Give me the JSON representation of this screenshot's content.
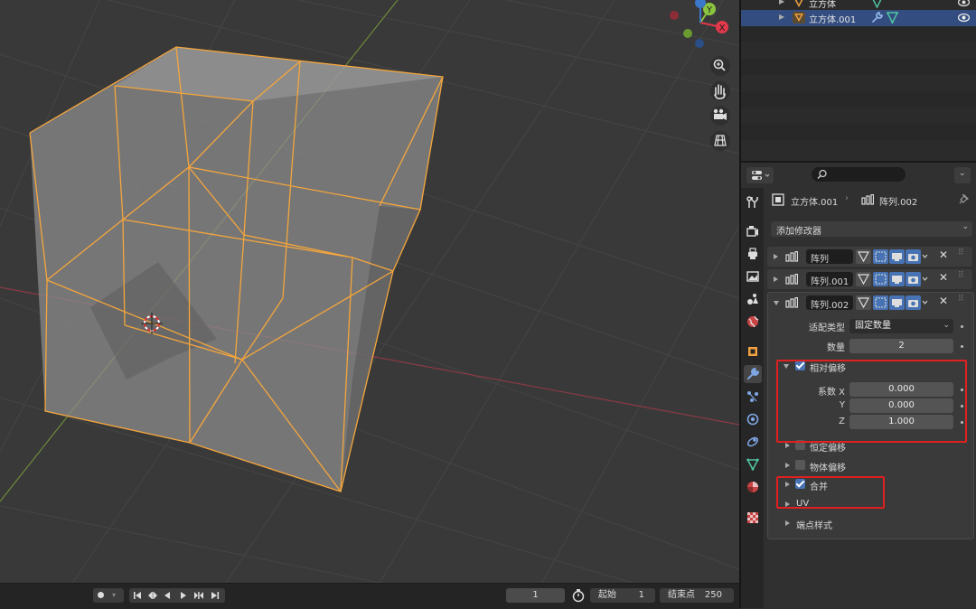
{
  "outliner": {
    "rows": [
      {
        "name": "立方体",
        "selected": false
      },
      {
        "name": "立方体.001",
        "selected": true
      }
    ]
  },
  "gizmo": {
    "y_label": "Y",
    "x_label": "X"
  },
  "properties": {
    "breadcrumb_object": "立方体.001",
    "breadcrumb_modifier": "阵列.002",
    "add_modifier_label": "添加修改器",
    "modifiers": [
      {
        "name": "阵列",
        "expanded": false
      },
      {
        "name": "阵列.001",
        "expanded": false
      },
      {
        "name": "阵列.002",
        "expanded": true
      }
    ],
    "fit_type_label": "适配类型",
    "fit_type_value": "固定数量",
    "count_label": "数量",
    "count_value": "2",
    "relative_offset": {
      "label": "相对偏移",
      "checked": true,
      "factor_x_label": "系数 X",
      "factor_x": "0.000",
      "factor_y_label": "Y",
      "factor_y": "0.000",
      "factor_z_label": "Z",
      "factor_z": "1.000"
    },
    "constant_offset": {
      "label": "恒定偏移",
      "checked": false
    },
    "object_offset": {
      "label": "物体偏移",
      "checked": false
    },
    "merge": {
      "label": "合并",
      "checked": true
    },
    "uv_label": "UV",
    "cap_label": "端点样式"
  },
  "timeline": {
    "current_frame": "1",
    "start_label": "起始",
    "start_value": "1",
    "end_label": "结束点",
    "end_value": "250"
  },
  "colors": {
    "selection_orange": "#f5a63c",
    "accent_blue": "#4772b3",
    "annotation_red": "#e02020",
    "axis_x": "#e2394b",
    "axis_y": "#8bc53f",
    "axis_z": "#3b78c9"
  }
}
